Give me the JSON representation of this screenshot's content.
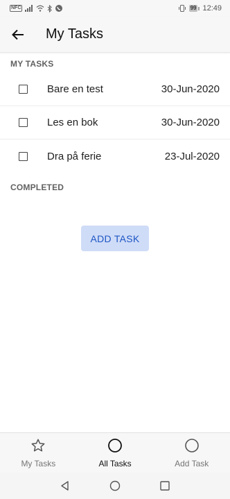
{
  "status_bar": {
    "time": "12:49",
    "battery": "99",
    "nfc": "NFC"
  },
  "app_bar": {
    "title": "My Tasks"
  },
  "sections": {
    "my_tasks": "MY TASKS",
    "completed": "COMPLETED"
  },
  "tasks": [
    {
      "name": "Bare en test",
      "date": "30-Jun-2020",
      "checked": false
    },
    {
      "name": "Les en bok",
      "date": "30-Jun-2020",
      "checked": false
    },
    {
      "name": "Dra på ferie",
      "date": "23-Jul-2020",
      "checked": false
    }
  ],
  "add_task_button": "ADD TASK",
  "bottom_nav": {
    "items": [
      {
        "label": "My Tasks",
        "icon": "star-icon",
        "active": false
      },
      {
        "label": "All Tasks",
        "icon": "circle-icon",
        "active": true
      },
      {
        "label": "Add Task",
        "icon": "circle-icon",
        "active": false
      }
    ]
  },
  "colors": {
    "accent": "#1e56c4",
    "button_bg": "#cfdcf7",
    "bar_bg": "#f7f7f7"
  }
}
